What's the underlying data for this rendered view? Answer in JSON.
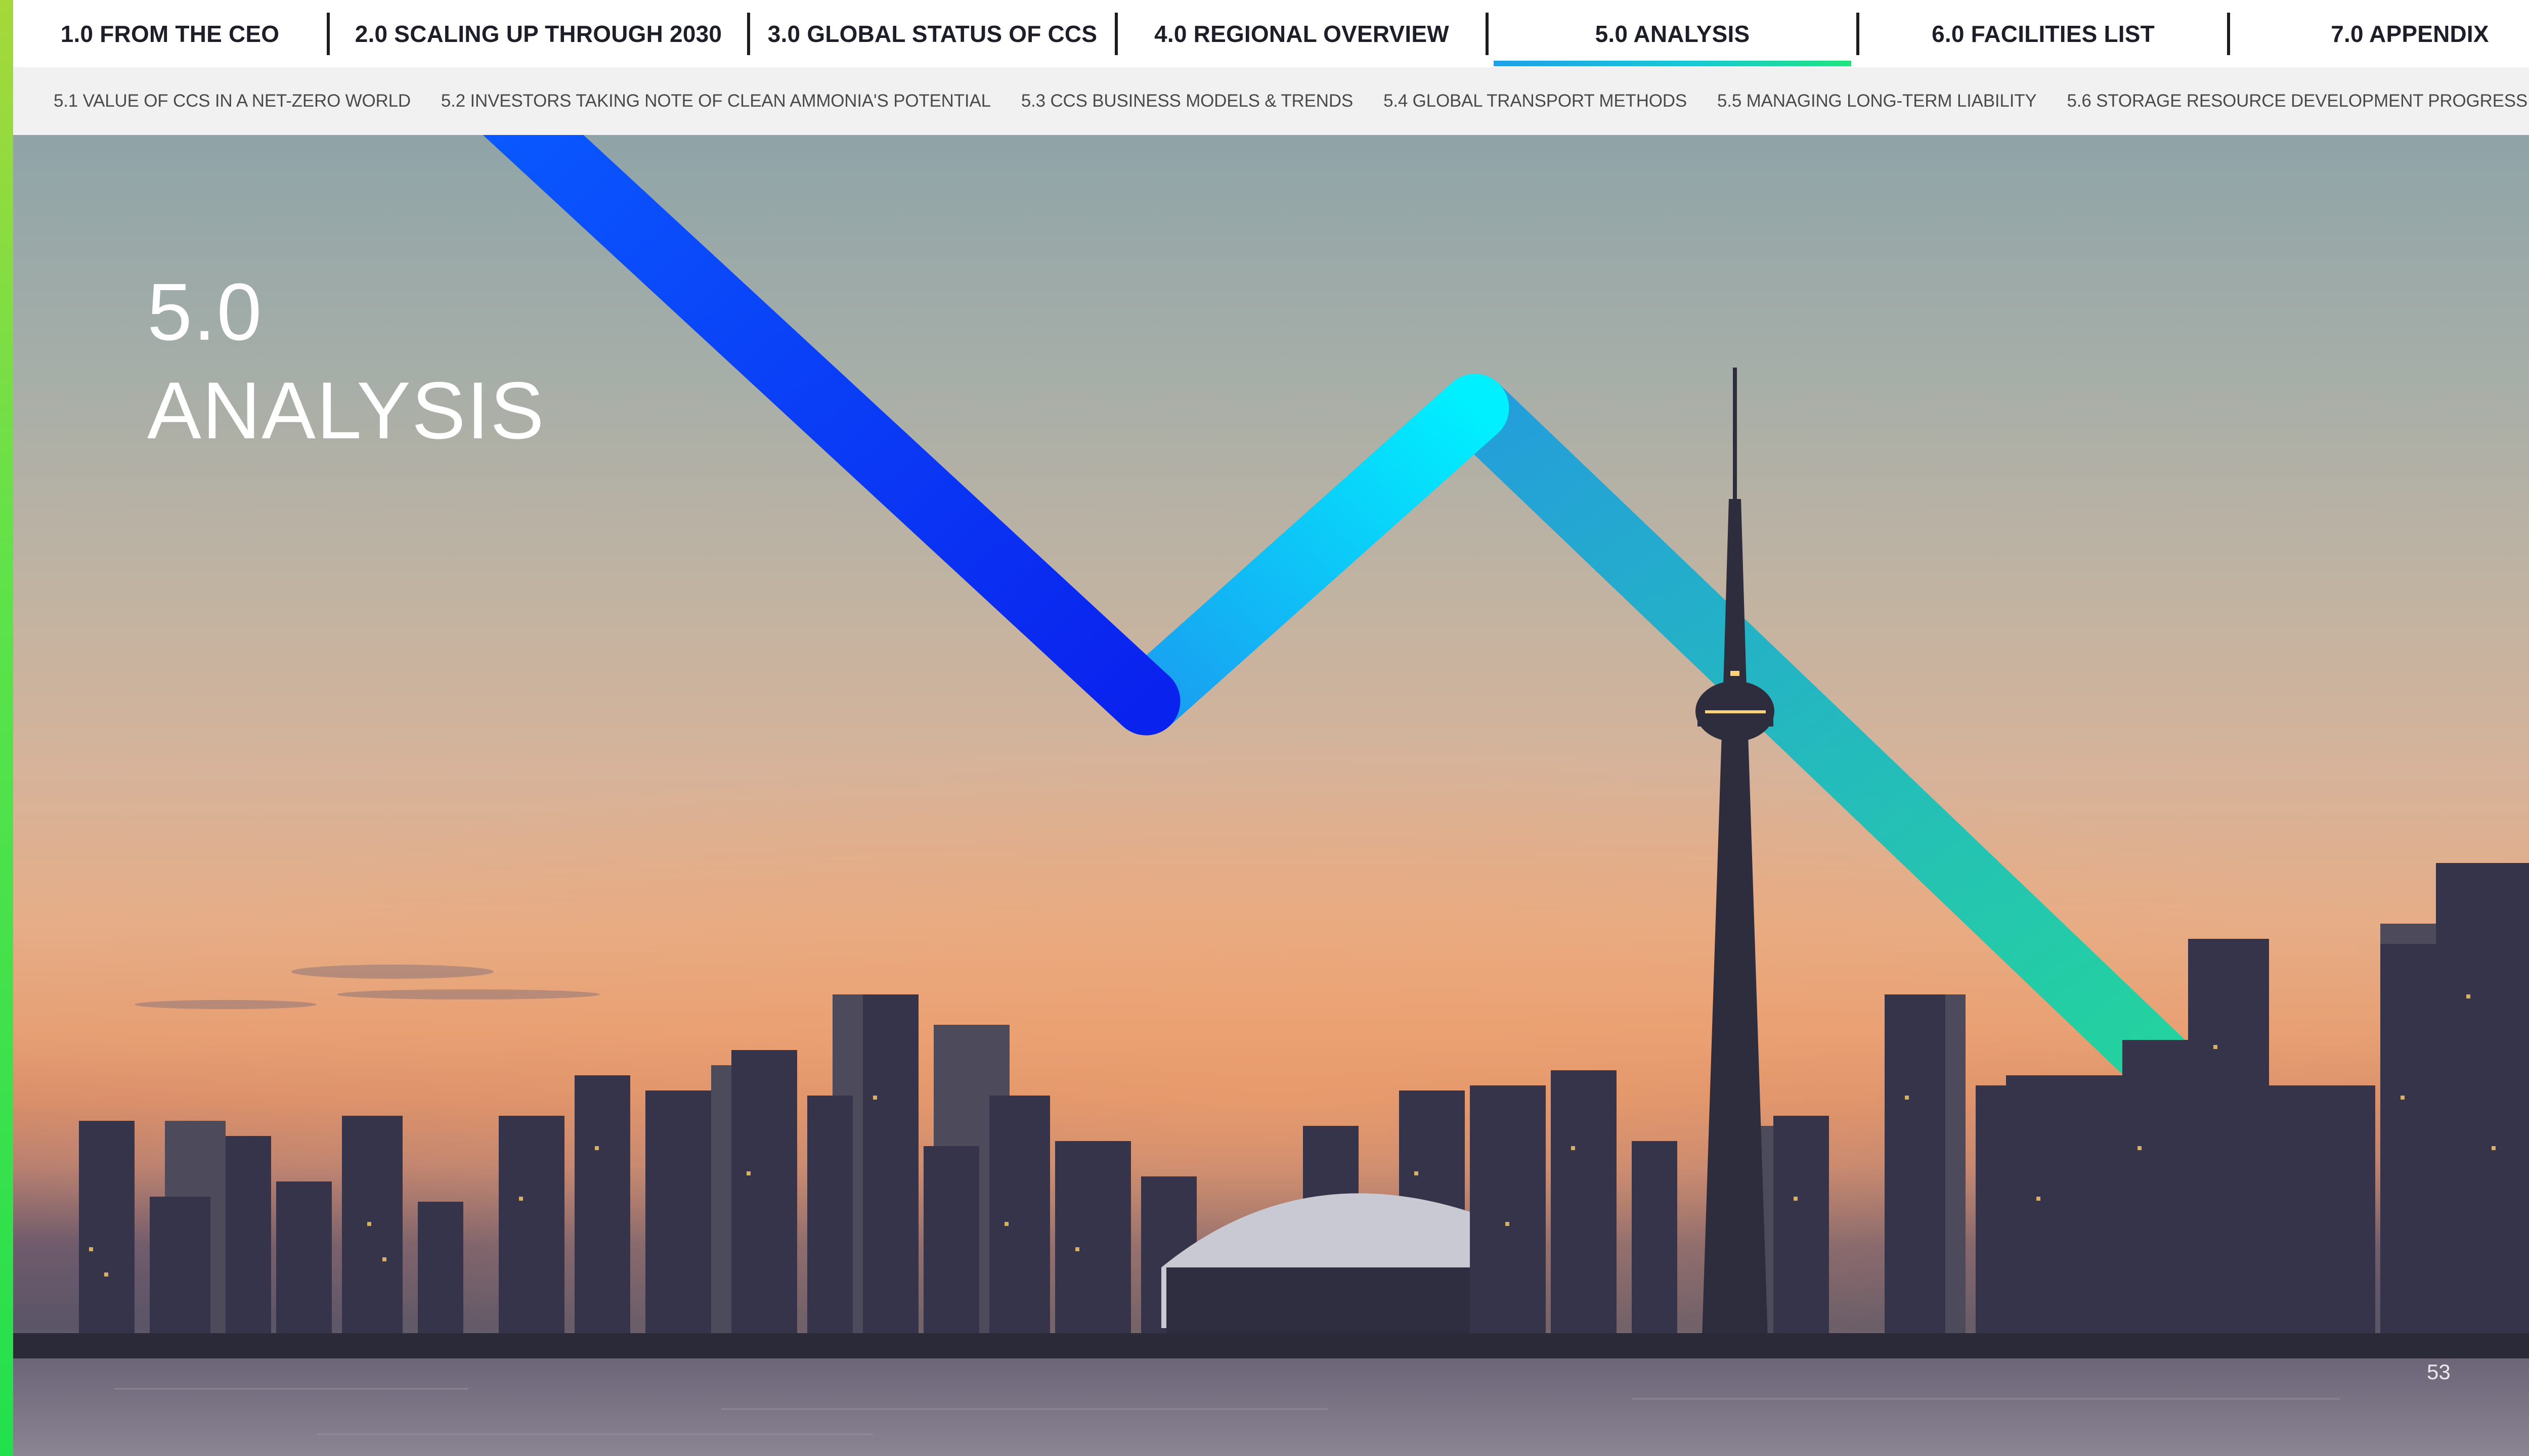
{
  "nav": {
    "tabs": [
      {
        "label": "1.0 FROM THE CEO"
      },
      {
        "label": "2.0 SCALING UP THROUGH 2030"
      },
      {
        "label": "3.0 GLOBAL STATUS OF CCS"
      },
      {
        "label": "4.0 REGIONAL OVERVIEW"
      },
      {
        "label": "5.0 ANALYSIS",
        "active": true
      },
      {
        "label": "6.0 FACILITIES LIST"
      },
      {
        "label": "7.0 APPENDIX"
      }
    ]
  },
  "subnav": {
    "items": [
      {
        "label": "5.1 VALUE OF CCS IN A NET-ZERO WORLD"
      },
      {
        "label": "5.2 INVESTORS TAKING NOTE OF CLEAN AMMONIA'S POTENTIAL"
      },
      {
        "label": "5.3 CCS BUSINESS MODELS & TRENDS"
      },
      {
        "label": "5.4 GLOBAL TRANSPORT METHODS"
      },
      {
        "label": "5.5 MANAGING LONG-TERM LIABILITY"
      },
      {
        "label": "5.6 STORAGE RESOURCE DEVELOPMENT PROGRESS"
      }
    ]
  },
  "hero": {
    "section_number": "5.0",
    "section_title": "ANALYSIS",
    "image": "toronto-skyline-sunset"
  },
  "footer": {
    "page_number": "53"
  },
  "colors": {
    "accent_blue_dark": "#0a2cf0",
    "accent_blue": "#1fa0e8",
    "accent_cyan": "#00e6ff",
    "accent_green": "#12d6a0",
    "active_underline_start": "#1fa0e8",
    "active_underline_end": "#1ee47c",
    "left_stripe": "#3fdc44"
  }
}
